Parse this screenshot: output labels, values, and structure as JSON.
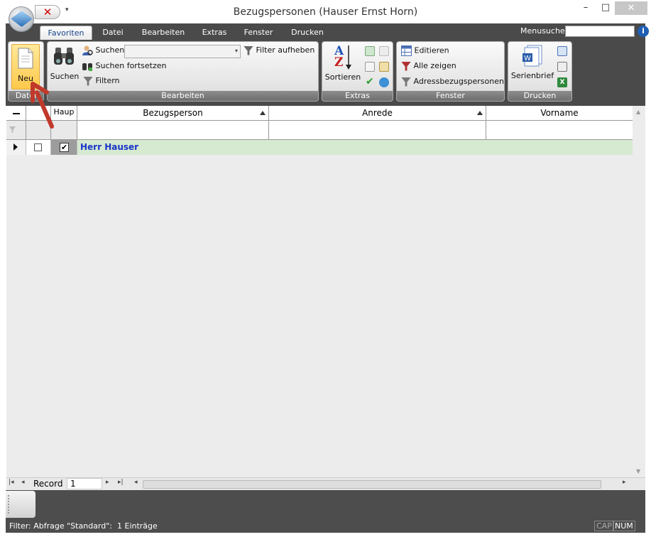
{
  "window": {
    "title": "Bezugspersonen (Hauser Ernst Horn)",
    "minimize_glyph": "–",
    "maximize_glyph": "□",
    "close_glyph": "✕"
  },
  "tabs": [
    {
      "label": "Favoriten",
      "active": true
    },
    {
      "label": "Datei"
    },
    {
      "label": "Bearbeiten"
    },
    {
      "label": "Extras"
    },
    {
      "label": "Fenster"
    },
    {
      "label": "Drucken"
    }
  ],
  "menusuche": {
    "label": "Menusuche",
    "value": "",
    "help_glyph": "i"
  },
  "ribbon": {
    "datei": {
      "group_label": "Datei",
      "neu_label": "Neu"
    },
    "bearbeiten": {
      "group_label": "Bearbeiten",
      "suchen_big_label": "Suchen",
      "suchen_label": "Suchen",
      "suchen_value": "",
      "suchen_fortsetzen_label": "Suchen fortsetzen",
      "filtern_label": "Filtern",
      "filter_aufheben_label": "Filter aufheben"
    },
    "extras": {
      "group_label": "Extras",
      "sortieren_label": "Sortieren",
      "az_top": "A",
      "az_bottom": "Z"
    },
    "fenster": {
      "group_label": "Fenster",
      "editieren_label": "Editieren",
      "alle_zeigen_label": "Alle zeigen",
      "adressbezugspersonen_label": "Adressbezugspersonen"
    },
    "drucken": {
      "group_label": "Drucken",
      "serienbrief_label": "Serienbrief"
    }
  },
  "grid": {
    "columns": {
      "haupt": "Haup",
      "bezugsperson": "Bezugsperson",
      "anrede": "Anrede",
      "vorname": "Vorname"
    },
    "rows": [
      {
        "bezugsperson": "Herr Hauser",
        "checked": false,
        "haupt": true,
        "anrede": "",
        "vorname": ""
      }
    ]
  },
  "navigator": {
    "record_label": "Record",
    "record_value": "1"
  },
  "status": {
    "filter_text": "Filter: Abfrage \"Standard\":",
    "count_text": "1 Einträge",
    "cap": "CAP",
    "num": "NUM"
  },
  "colors": {
    "row_highlight": "#d5ead0",
    "link_text": "#1a35c8",
    "annotation_arrow": "#c0392b",
    "neu_button": "#ffd35e"
  }
}
